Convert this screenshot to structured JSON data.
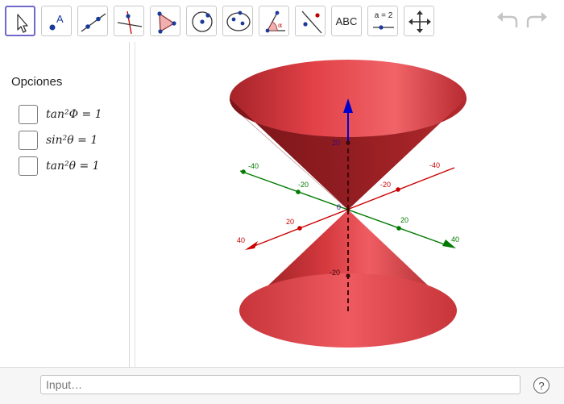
{
  "toolbar": {
    "tools": [
      {
        "name": "move-tool",
        "icon": "cursor-arrow-icon"
      },
      {
        "name": "point-tool",
        "icon": "point-a-icon"
      },
      {
        "name": "line-tool",
        "icon": "line-through-points-icon"
      },
      {
        "name": "perpendicular-line-tool",
        "icon": "perpendicular-line-icon"
      },
      {
        "name": "polygon-tool",
        "icon": "triangle-polygon-icon"
      },
      {
        "name": "circle-tool",
        "icon": "circle-center-point-icon"
      },
      {
        "name": "conic-tool",
        "icon": "ellipse-points-icon"
      },
      {
        "name": "angle-tool",
        "icon": "angle-alpha-icon"
      },
      {
        "name": "reflect-tool",
        "icon": "reflect-about-line-icon"
      },
      {
        "name": "text-tool",
        "label": "ABC"
      },
      {
        "name": "slider-tool",
        "label": "a = 2"
      },
      {
        "name": "move-graphics-view-tool",
        "icon": "four-arrows-icon"
      }
    ],
    "undo_icon": "undo-icon",
    "redo_icon": "redo-icon",
    "accent": "#6f69c8"
  },
  "algebra": {
    "title": "Opciones",
    "options": [
      {
        "label": "tan²Φ = 1",
        "checked": false
      },
      {
        "label": "sin²θ = 1",
        "checked": false
      },
      {
        "label": "tan²θ = 1",
        "checked": false
      }
    ]
  },
  "graphics": {
    "axis_labels": {
      "x_neg": [
        "-40",
        "-20"
      ],
      "x_pos": [
        "20",
        "40"
      ],
      "y_neg": [
        "-40",
        "-20"
      ],
      "y_pos": [
        "20",
        "40"
      ],
      "z_pos": "20",
      "z_neg": "-20",
      "origin": "0"
    },
    "colors": {
      "cone": "#d9383d",
      "x_axis": "#cc0000",
      "y_axis": "#007a00",
      "z_axis": "#0000cc"
    }
  },
  "input": {
    "placeholder": "Input…"
  },
  "help": {
    "label": "?"
  }
}
